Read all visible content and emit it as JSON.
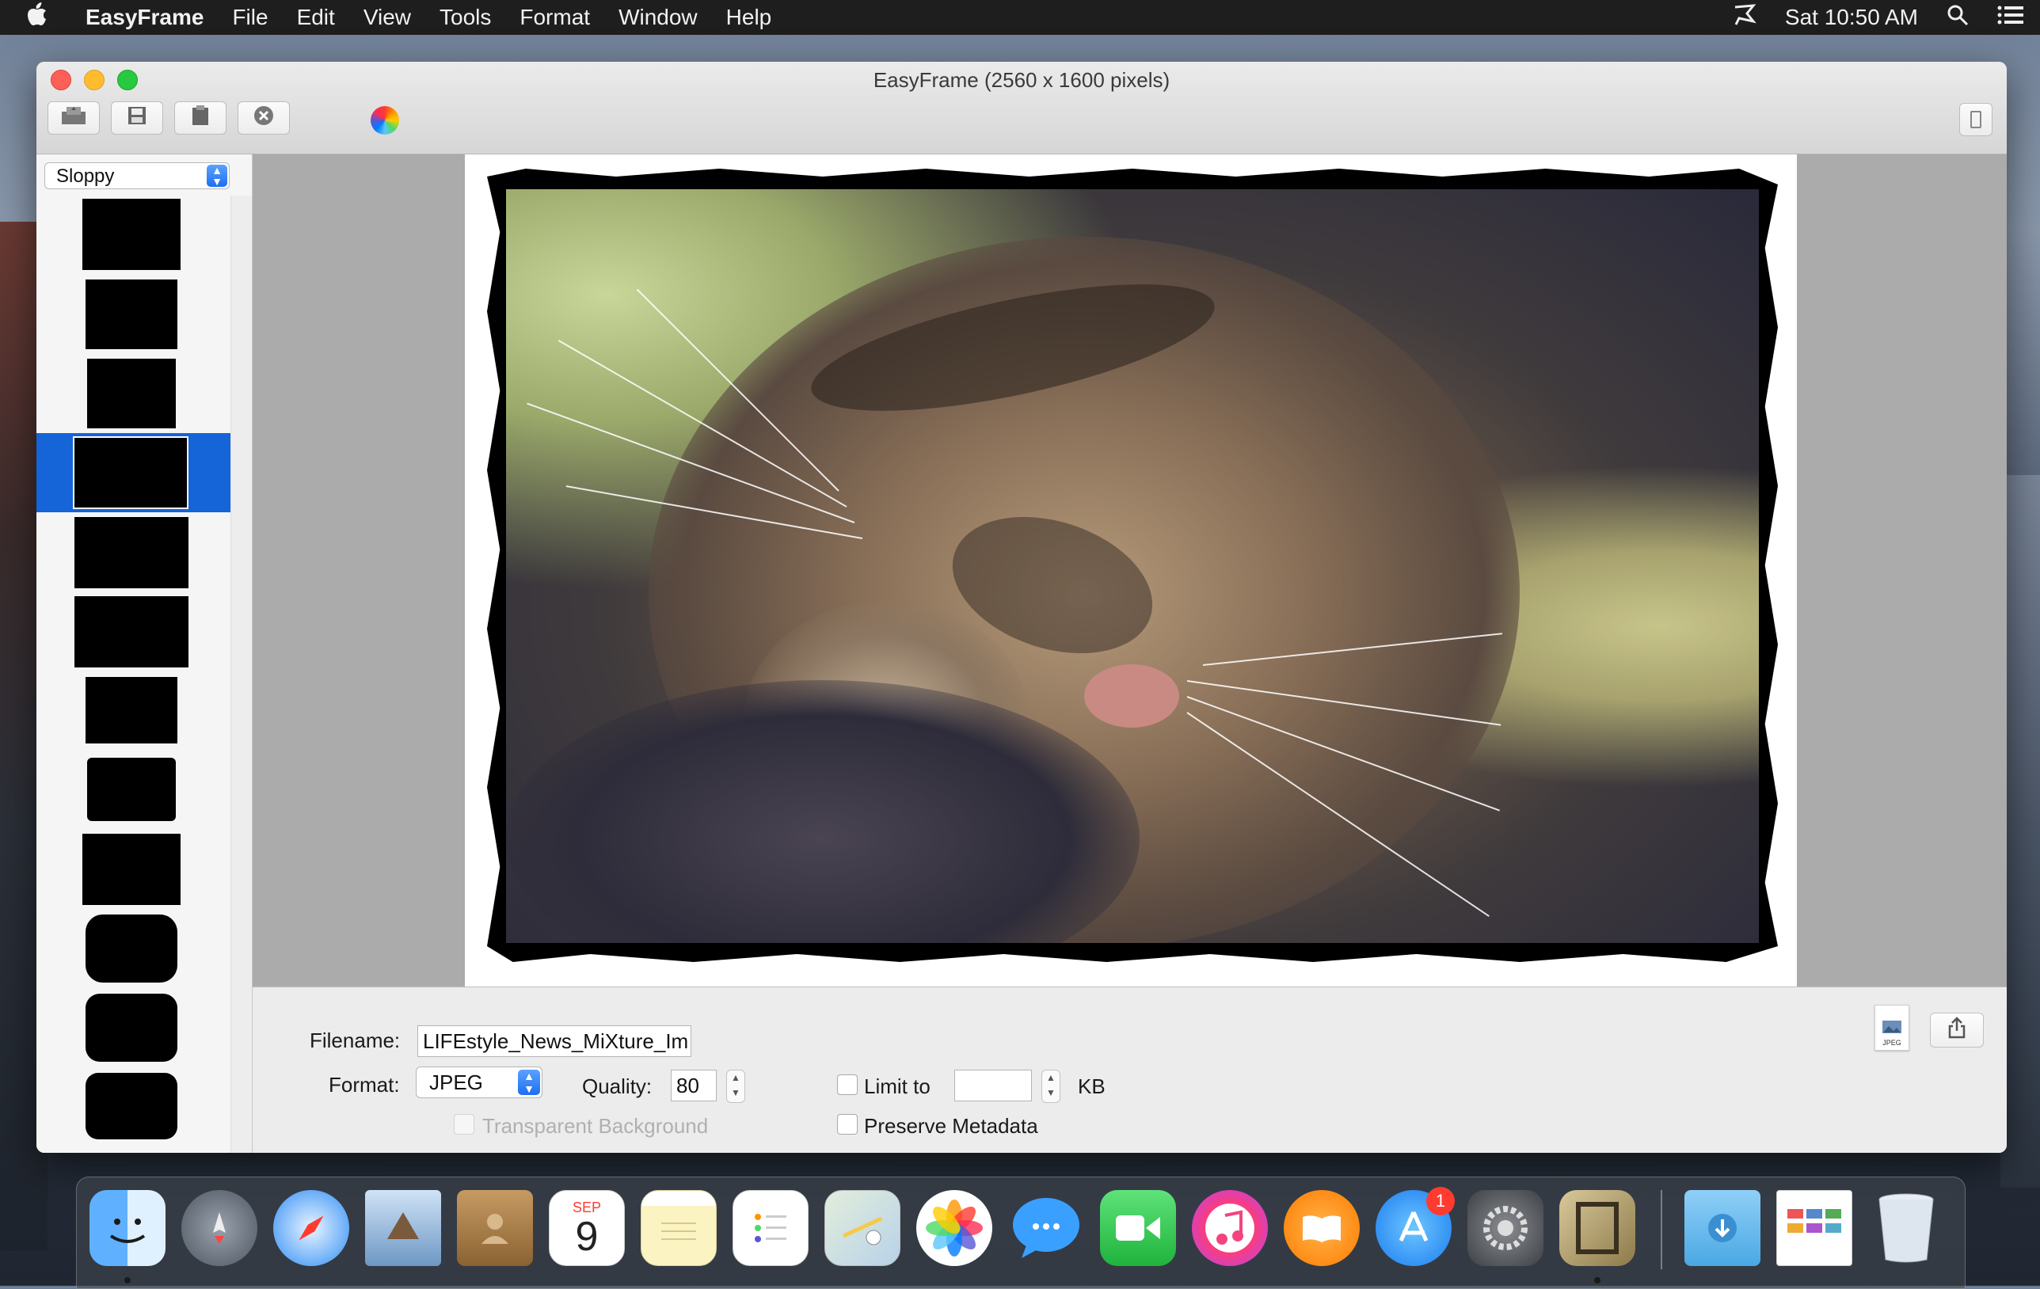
{
  "menubar": {
    "apple": "",
    "app": "EasyFrame",
    "items": [
      "File",
      "Edit",
      "View",
      "Tools",
      "Format",
      "Window",
      "Help"
    ],
    "clock": "Sat 10:50 AM"
  },
  "window": {
    "title": "EasyFrame (2560 x 1600 pixels)",
    "toolbar": {
      "open_icon": "open-image-icon",
      "save_icon": "save-icon",
      "clipboard_icon": "clipboard-icon",
      "close_icon": "close-image-icon",
      "color_icon": "color-wheel-icon"
    }
  },
  "sidebar": {
    "style_select": "Sloppy",
    "thumbnails_count": 12,
    "selected_index": 3
  },
  "export": {
    "filename_label": "Filename:",
    "filename_value": "LIFEstyle_News_MiXture_Im",
    "format_label": "Format:",
    "format_value": "JPEG",
    "quality_label": "Quality:",
    "quality_value": "80",
    "limit_label": "Limit to",
    "limit_value": "",
    "limit_unit": "KB",
    "transparent_label": "Transparent Background",
    "metadata_label": "Preserve Metadata",
    "jpeg_badge": "JPEG"
  },
  "dock": {
    "apps": [
      "Finder",
      "Launchpad",
      "Safari",
      "Mail",
      "Contacts",
      "Calendar",
      "Notes",
      "Reminders",
      "Maps",
      "Photos",
      "Messages",
      "FaceTime",
      "iTunes",
      "iBooks",
      "App Store",
      "System Preferences",
      "EasyFrame",
      "Downloads",
      "Preview",
      "Trash"
    ],
    "calendar_month": "SEP",
    "calendar_day": "9",
    "appstore_badge": "1"
  },
  "colors": {
    "accent": "#1564d8",
    "select_blue": "#1d6ff2",
    "badge_red": "#ff3b30"
  }
}
